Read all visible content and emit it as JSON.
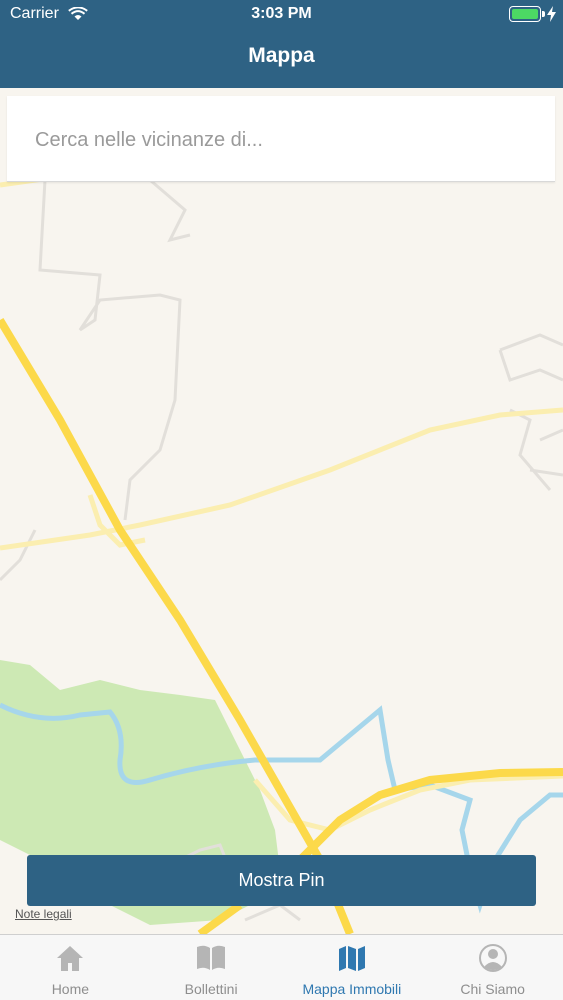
{
  "status_bar": {
    "carrier": "Carrier",
    "time": "3:03 PM"
  },
  "header": {
    "title": "Mappa"
  },
  "search": {
    "placeholder": "Cerca nelle vicinanze di..."
  },
  "actions": {
    "show_pin_label": "Mostra Pin"
  },
  "map": {
    "legal_label": "Note legali"
  },
  "tabbar": {
    "items": [
      {
        "label": "Home",
        "icon": "home-icon",
        "active": false
      },
      {
        "label": "Bollettini",
        "icon": "book-icon",
        "active": false
      },
      {
        "label": "Mappa Immobili",
        "icon": "map-icon",
        "active": true
      },
      {
        "label": "Chi Siamo",
        "icon": "user-icon",
        "active": false
      }
    ]
  },
  "colors": {
    "header": "#2e6284",
    "accent": "#2f78b0",
    "road_major": "#fcd94a",
    "road_minor": "#fbeeb0",
    "park": "#cde9b4",
    "water": "#a6d6eb",
    "background": "#f8f5ef"
  }
}
